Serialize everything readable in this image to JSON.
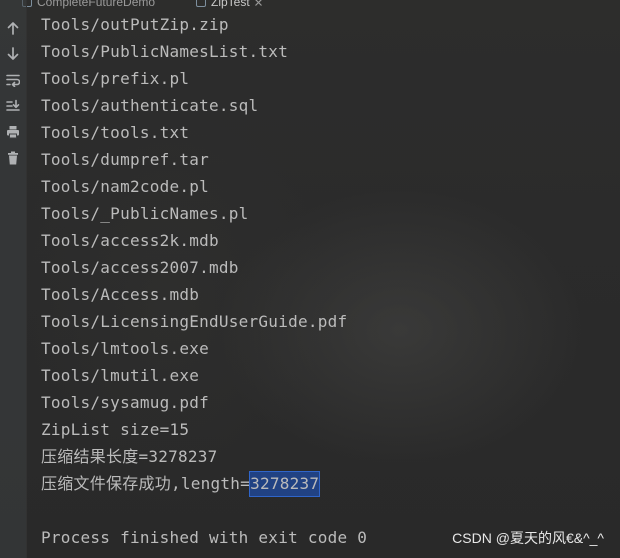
{
  "tabs": [
    {
      "label": "CompleteFutureDemo",
      "icon": "class-file-icon"
    },
    {
      "label": "ZipTest",
      "icon": "class-file-icon",
      "active": true
    }
  ],
  "toolbar": {
    "tools": [
      {
        "name": "up-stack-trace-icon"
      },
      {
        "name": "down-stack-trace-icon"
      },
      {
        "name": "soft-wrap-icon"
      },
      {
        "name": "scroll-to-end-icon"
      },
      {
        "name": "print-icon"
      },
      {
        "name": "clear-all-icon"
      }
    ]
  },
  "console": {
    "lines": [
      "Tools/outPutZip.zip",
      "Tools/PublicNamesList.txt",
      "Tools/prefix.pl",
      "Tools/authenticate.sql",
      "Tools/tools.txt",
      "Tools/dumpref.tar",
      "Tools/nam2code.pl",
      "Tools/_PublicNames.pl",
      "Tools/access2k.mdb",
      "Tools/access2007.mdb",
      "Tools/Access.mdb",
      "Tools/LicensingEndUserGuide.pdf",
      "Tools/lmtools.exe",
      "Tools/lmutil.exe",
      "Tools/sysamug.pdf",
      "ZipList size=15",
      "压缩结果长度=3278237"
    ],
    "last_line_prefix": "压缩文件保存成功,length=",
    "selected_text": "3278237",
    "exit_message": "Process finished with exit code 0"
  },
  "watermark": "CSDN @夏天的风€&^_^",
  "colors": {
    "background": "#2b2b2b",
    "text": "#bbbbbb",
    "selection": "#214283",
    "icon": "#afb1b3"
  }
}
